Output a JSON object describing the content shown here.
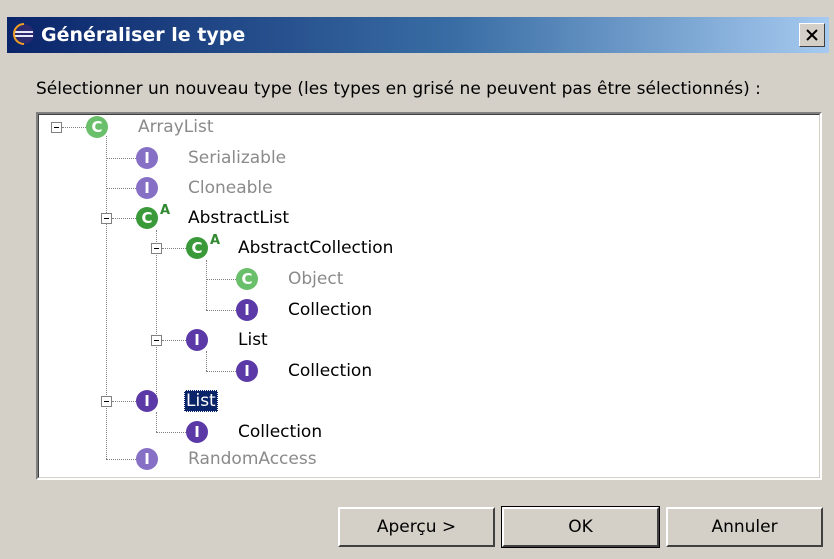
{
  "dialog": {
    "title": "Généraliser le type",
    "instruction": "Sélectionner un nouveau type (les types en grisé ne peuvent pas être sélectionnés) :"
  },
  "tree": {
    "items": [
      {
        "label": "ArrayList",
        "kind": "class",
        "dim": true
      },
      {
        "label": "Serializable",
        "kind": "interface",
        "dim": true
      },
      {
        "label": "Cloneable",
        "kind": "interface",
        "dim": true
      },
      {
        "label": "AbstractList",
        "kind": "class",
        "abstract": true,
        "dim": false
      },
      {
        "label": "AbstractCollection",
        "kind": "class",
        "abstract": true,
        "dim": false
      },
      {
        "label": "Object",
        "kind": "class",
        "dim": true
      },
      {
        "label": "Collection",
        "kind": "interface",
        "dim": false
      },
      {
        "label": "List",
        "kind": "interface",
        "dim": false
      },
      {
        "label": "Collection",
        "kind": "interface",
        "dim": false
      },
      {
        "label": "List",
        "kind": "interface",
        "dim": false,
        "selected": true
      },
      {
        "label": "Collection",
        "kind": "interface",
        "dim": false
      },
      {
        "label": "RandomAccess",
        "kind": "interface",
        "dim": true
      }
    ],
    "class_glyph": "C",
    "interface_glyph": "I",
    "abstract_marker": "A"
  },
  "buttons": {
    "preview": "Aperçu >",
    "ok": "OK",
    "cancel": "Annuler"
  },
  "icons": {
    "title_icon": "eclipse-icon",
    "close_icon": "close-icon"
  },
  "colors": {
    "selection": "#0a246a",
    "class_icon": "#3a9a3a",
    "interface_icon": "#5b3aa8",
    "disabled_text": "#8a8a8a"
  }
}
